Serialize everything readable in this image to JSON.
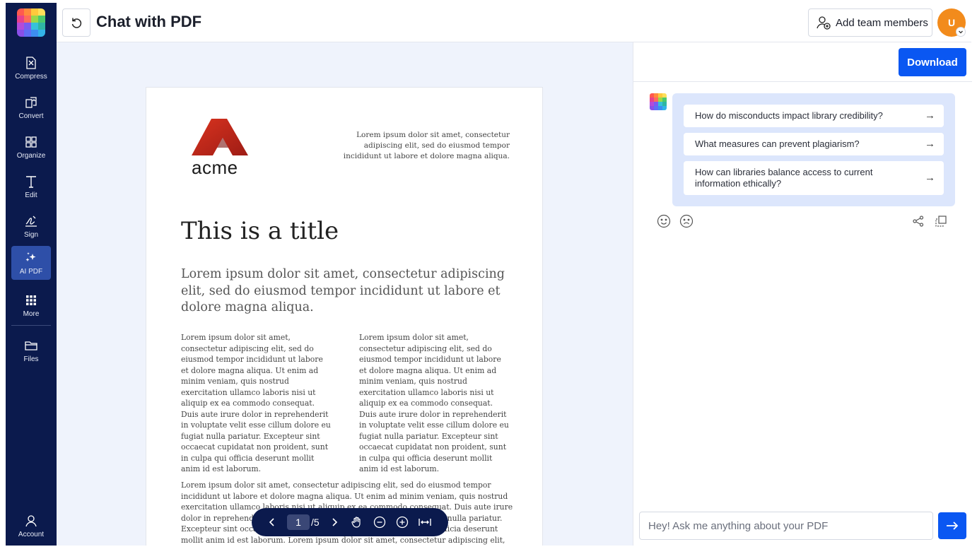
{
  "header": {
    "title": "Chat with PDF",
    "add_team_label": "Add team members",
    "avatar_initial": "U"
  },
  "sidebar": {
    "items": [
      {
        "label": "Compress",
        "icon": "compress-icon"
      },
      {
        "label": "Convert",
        "icon": "convert-icon"
      },
      {
        "label": "Organize",
        "icon": "organize-icon"
      },
      {
        "label": "Edit",
        "icon": "edit-text-icon"
      },
      {
        "label": "Sign",
        "icon": "signature-icon"
      },
      {
        "label": "AI PDF",
        "icon": "sparkles-icon",
        "active": true
      },
      {
        "label": "More",
        "icon": "grid-dots-icon"
      },
      {
        "label": "Files",
        "icon": "folder-icon"
      }
    ],
    "account_label": "Account"
  },
  "document": {
    "logo_word": "acme",
    "header_text": "Lorem ipsum dolor sit amet, consectetur adipiscing elit, sed do eiusmod tempor incididunt ut labore et dolore magna aliqua.",
    "title": "This is a title",
    "lead": "Lorem ipsum dolor sit amet, consectetur adipiscing elit, sed do eiusmod tempor incididunt ut labore et dolore magna aliqua.",
    "col_left": "Lorem ipsum dolor sit amet, consectetur adipiscing elit, sed do eiusmod tempor incididunt ut labore et dolore magna aliqua. Ut enim ad minim veniam, quis nostrud exercitation ullamco laboris nisi ut aliquip ex ea commodo consequat. Duis aute irure dolor in reprehenderit in voluptate velit esse cillum dolore eu fugiat nulla pariatur. Excepteur sint occaecat cupidatat non proident, sunt in culpa qui officia deserunt mollit anim id est laborum.",
    "col_right": "Lorem ipsum dolor sit amet, consectetur adipiscing elit, sed do eiusmod tempor incididunt ut labore et dolore magna aliqua. Ut enim ad minim veniam, quis nostrud exercitation ullamco laboris nisi ut aliquip ex ea commodo consequat. Duis aute irure dolor in reprehenderit in voluptate velit esse cillum dolore eu fugiat nulla pariatur. Excepteur sint occaecat cupidatat non proident, sunt in culpa qui officia deserunt mollit anim id est laborum.",
    "para_bottom": "Lorem ipsum dolor sit amet, consectetur adipiscing elit, sed do eiusmod tempor incididunt ut labore et dolore magna aliqua. Ut enim ad minim veniam, quis nostrud exercitation ullamco laboris nisi ut aliquip ex ea commodo consequat. Duis aute irure dolor in reprehenderit in voluptate velit esse cillum dolore eu fugiat nulla pariatur. Excepteur sint occaecat cupidatat non proident, sunt in culpa qui officia deserunt mollit anim id est laborum. Lorem ipsum dolor sit amet, consectetur adipiscing elit, sed do"
  },
  "viewer_toolbar": {
    "current_page": "1",
    "total_pages": "/5"
  },
  "chat": {
    "download_label": "Download",
    "suggestions": [
      "How do misconducts impact library credibility?",
      "What measures can prevent plagiarism?",
      "How can libraries balance access to current information ethically?"
    ],
    "suggestion_arrow": "→",
    "input_placeholder": "Hey! Ask me anything about your PDF"
  },
  "colors": {
    "sidebar_bg": "#0b1a4d",
    "accent_blue": "#0a57f2",
    "avatar_orange": "#f28b1c",
    "suggestion_bg": "#dce6fc",
    "viewer_bg": "#eff3fc"
  }
}
